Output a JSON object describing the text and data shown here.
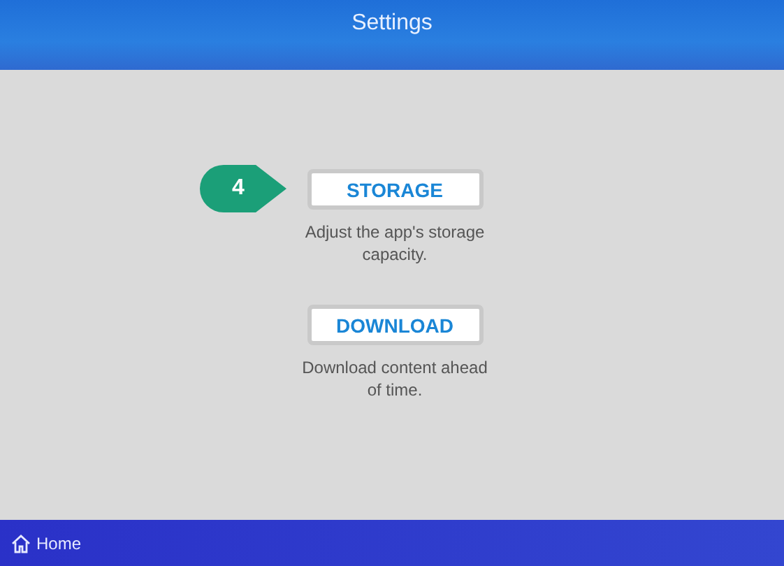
{
  "header": {
    "title": "Settings"
  },
  "options": [
    {
      "label": "STORAGE",
      "description": "Adjust the app's storage capacity.",
      "callout": "4"
    },
    {
      "label": "DOWNLOAD",
      "description": "Download content ahead of time."
    }
  ],
  "footer": {
    "home": "Home"
  }
}
